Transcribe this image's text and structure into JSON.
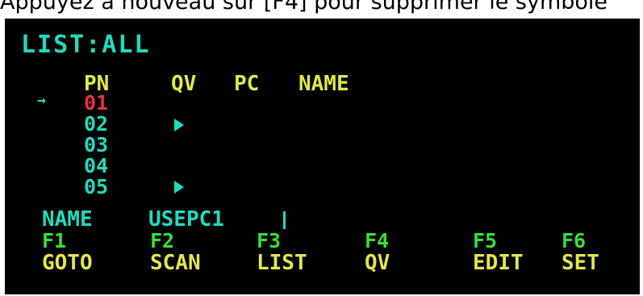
{
  "caption": "Appuyez à nouveau sur [F4] pour supprimer le symbole",
  "screen": {
    "title": "LIST:ALL",
    "columns": {
      "pn": "PN",
      "qv": "QV",
      "pc": "PC",
      "name": "NAME"
    },
    "selection_arrow": "→",
    "ports": [
      "01",
      "02",
      "03",
      "04",
      "05"
    ],
    "qv_marked_ports": [
      "02",
      "05"
    ],
    "name_field": {
      "label": "NAME",
      "value": "USEPC1"
    },
    "function_keys": [
      {
        "key": "F1",
        "label": "GOTO"
      },
      {
        "key": "F2",
        "label": "SCAN"
      },
      {
        "key": "F3",
        "label": "LIST"
      },
      {
        "key": "F4",
        "label": "QV"
      },
      {
        "key": "F5",
        "label": "EDIT"
      },
      {
        "key": "F6",
        "label": "SET"
      }
    ],
    "colors": {
      "background": "#000000",
      "title": "#1edcc0",
      "header": "#e3e845",
      "selected_port": "#e8323a",
      "port": "#1edcc0",
      "function_key": "#35e13a",
      "function_label": "#e3e845"
    }
  }
}
